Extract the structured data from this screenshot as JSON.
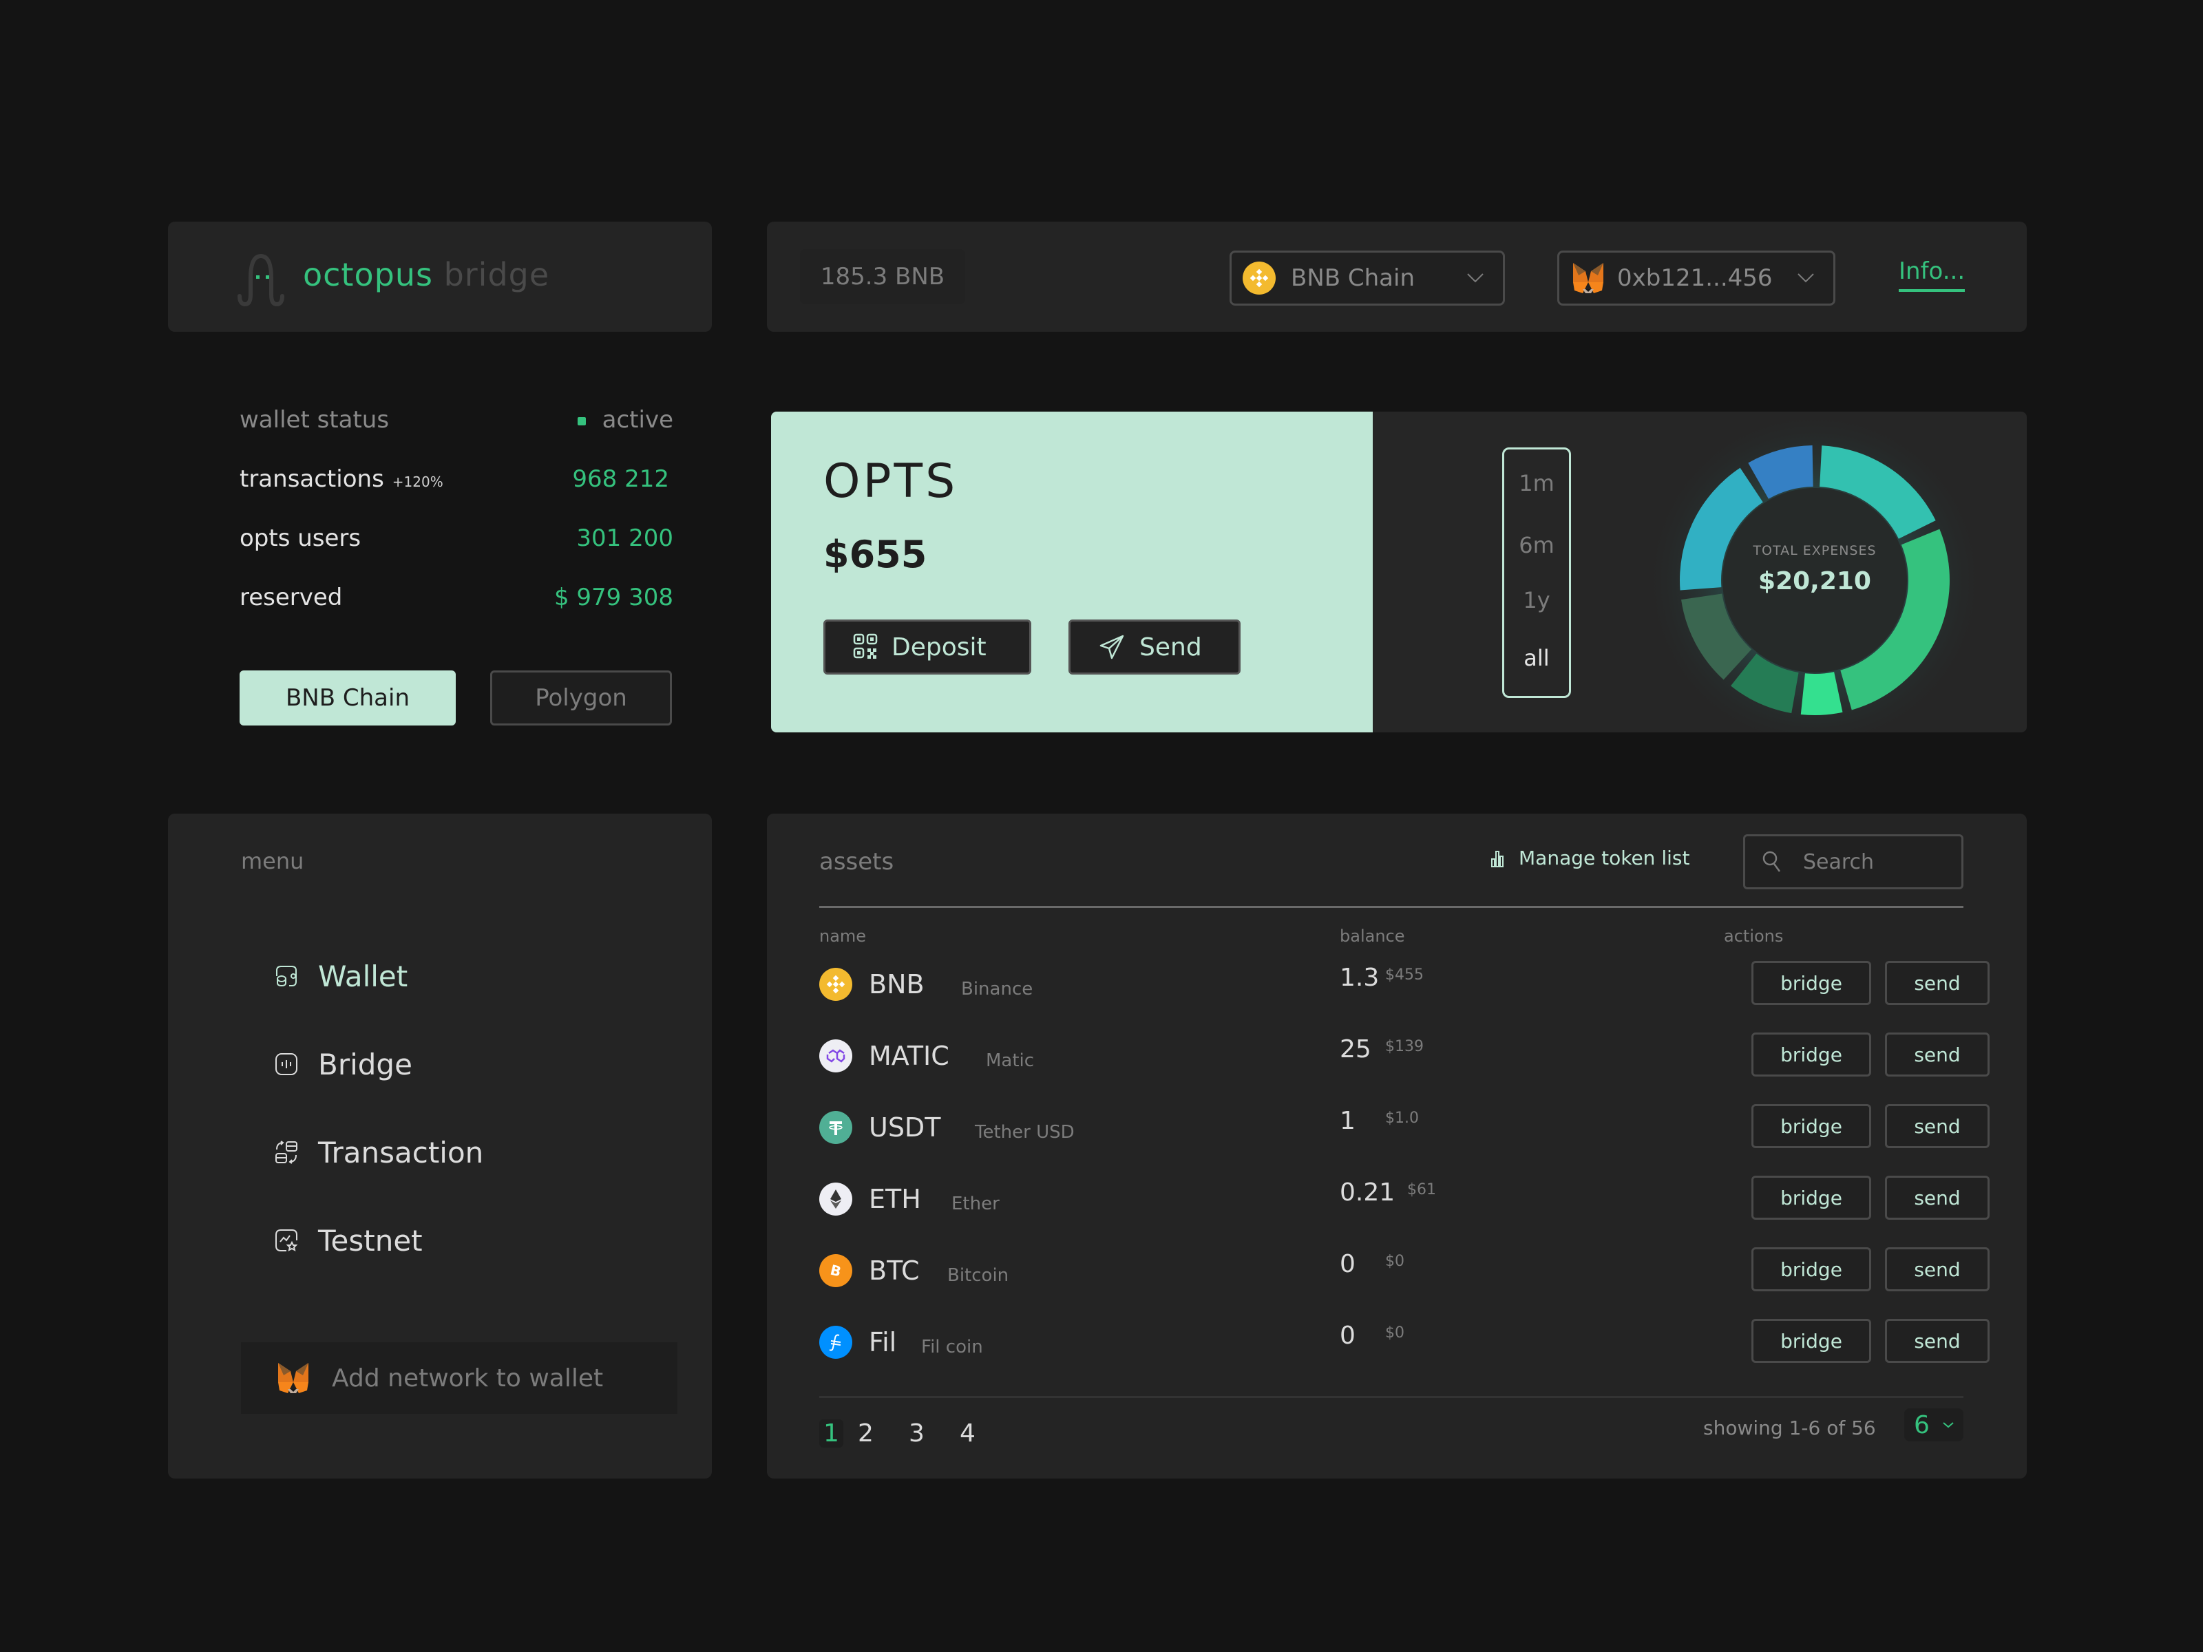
{
  "brand": {
    "name_primary": "octopus",
    "name_secondary": "bridge",
    "accent": "#35c27e",
    "mint": "#c0e7d6"
  },
  "header": {
    "balance": "185.3 BNB",
    "chain_selector": {
      "icon": "bnb-coin-icon",
      "value": "BNB Chain"
    },
    "wallet_selector": {
      "icon": "metamask-fox-icon",
      "value": "0xb121...456"
    },
    "info_link": "Info..."
  },
  "stats": {
    "wallet_status": {
      "label": "wallet status",
      "value": "active"
    },
    "transactions": {
      "label": "transactions",
      "change": "+120%",
      "value": "968 212"
    },
    "users": {
      "label": "opts users",
      "value": "301 200"
    },
    "reserved": {
      "label": "reserved",
      "value": "$ 979 308"
    },
    "networks": [
      {
        "label": "BNB Chain",
        "active": true
      },
      {
        "label": "Polygon",
        "active": false
      }
    ]
  },
  "opts_card": {
    "title": "OPTS",
    "value": "$655",
    "deposit_label": "Deposit",
    "send_label": "Send"
  },
  "chart_panel": {
    "ranges": [
      "1m",
      "6m",
      "1y",
      "all"
    ],
    "selected_range": "all"
  },
  "chart_data": {
    "type": "pie",
    "variant": "donut",
    "title": "TOTAL EXPENSES",
    "center_value": "$20,210",
    "series": [
      {
        "name": "segment-1",
        "value": 17,
        "color": "#33c1b0"
      },
      {
        "name": "segment-2",
        "value": 27,
        "color": "#35c27e"
      },
      {
        "name": "segment-3",
        "value": 5,
        "color": "#34e08f"
      },
      {
        "name": "segment-4",
        "value": 8,
        "color": "#257c55"
      },
      {
        "name": "segment-5",
        "value": 11,
        "color": "#3a6650"
      },
      {
        "name": "segment-6",
        "value": 17,
        "color": "#31b0c3"
      },
      {
        "name": "segment-7",
        "value": 8,
        "color": "#3580c4"
      }
    ],
    "legend": "none"
  },
  "menu": {
    "title": "menu",
    "items": [
      {
        "label": "Wallet",
        "icon": "wallet-coins-icon",
        "active": true
      },
      {
        "label": "Bridge",
        "icon": "bridge-icon",
        "active": false
      },
      {
        "label": "Transaction",
        "icon": "transaction-swap-icon",
        "active": false
      },
      {
        "label": "Testnet",
        "icon": "testnet-chart-icon",
        "active": false
      }
    ],
    "add_network_label": "Add network to wallet"
  },
  "assets": {
    "title": "assets",
    "manage_label": "Manage token list",
    "search_placeholder": "Search",
    "columns": {
      "name": "name",
      "balance": "balance",
      "actions": "actions"
    },
    "bridge_label": "bridge",
    "send_label": "send",
    "rows": [
      {
        "symbol": "BNB",
        "name": "Binance",
        "balance": "1.3",
        "usd": "$455",
        "icon": "bnb-coin-icon",
        "color": "#f3ba2f"
      },
      {
        "symbol": "MATIC",
        "name": "Matic",
        "balance": "25",
        "usd": "$139",
        "icon": "matic-coin-icon",
        "color": "#eeeef4"
      },
      {
        "symbol": "USDT",
        "name": "Tether USD",
        "balance": "1",
        "usd": "$1.0",
        "icon": "usdt-coin-icon",
        "color": "#50af95"
      },
      {
        "symbol": "ETH",
        "name": "Ether",
        "balance": "0.21",
        "usd": "$61",
        "icon": "eth-coin-icon",
        "color": "#eeeef4"
      },
      {
        "symbol": "BTC",
        "name": "Bitcoin",
        "balance": "0",
        "usd": "$0",
        "icon": "btc-coin-icon",
        "color": "#f7931a"
      },
      {
        "symbol": "Fil",
        "name": "Fil coin",
        "balance": "0",
        "usd": "$0",
        "icon": "fil-coin-icon",
        "color": "#0090ff"
      }
    ],
    "pagination": {
      "pages": [
        "1",
        "2",
        "3",
        "4"
      ],
      "current": "1",
      "showing": "showing 1-6 of 56",
      "page_size": "6"
    }
  }
}
